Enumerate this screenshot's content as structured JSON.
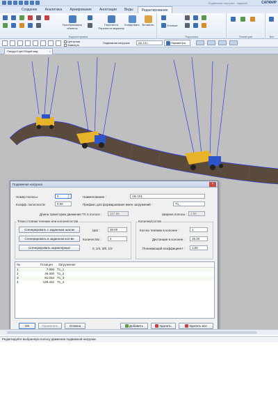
{
  "app": {
    "title": "Подвижная нагрузка - задача2",
    "brand": "САПФИР"
  },
  "tabs": [
    "Создание",
    "Аналитика",
    "Армирование",
    "Аннотации",
    "Виды",
    "Редактирование"
  ],
  "ribbon": {
    "group_left_label": "Корректировка",
    "group_mid_label": "Подложка",
    "group_geom_label": "Геометрия",
    "group_right_label": "Вкл",
    "btn_transform": "Преобразовать объекты",
    "btn_move_vertex": "Перенести вершину",
    "btn_move": "Перенести",
    "btn_copy": "Копировать",
    "btn_paste": "Вставить",
    "btn_angles": "Угловые"
  },
  "toolbar2": {
    "chk_centerline": "Центрная",
    "chk_close": "Замкнуть",
    "load_label": "Подвижная нагрузка:",
    "load_value": "АБ-151",
    "params_button": "Параметры"
  },
  "document_tab": "Пандус2.spf:Общий вид",
  "dialog": {
    "title": "Подвижная нагрузка",
    "strip_number_label": "Номер полосы:",
    "strip_number_value": "0",
    "reliability_label": "Коэфф. полосности:",
    "reliability_value": "0.00",
    "name_label": "Наименование :",
    "name_value": "АБ-151",
    "prefix_label": "Префикс для формирования имен загружений :",
    "prefix_value": "T1_",
    "trajectory_label": "Длина траектории движения ТС в полосе :",
    "trajectory_value": "157.65",
    "strip_width_label": "Ширина полосы :",
    "strip_width_value": "1.90",
    "set_title": "Точки стоянки тележек или колонн/состав",
    "btn_gen_step": "Сгенерировать с заданным шагом",
    "btn_gen_count": "Сгенерировать в заданном кол-ве",
    "btn_gen_char": "Сгенерировать характерные",
    "step_label": "Шаг :",
    "step_value": "30.00",
    "count_label": "Количество :",
    "count_value": "4",
    "fractions_hint": "0, 1/4, 3/8, 1/2",
    "column_title": "Колонна/состав",
    "carts_label": "Кол-во тележек в колонне :",
    "carts_value": "1",
    "distance_label": "Дистанция в колонне :",
    "distance_value": "16.20",
    "factor_label": "Понижающий коэффициент :",
    "factor_value": "1.00",
    "table": {
      "headers": [
        "№",
        "Позиция",
        "Загружение"
      ],
      "rows": [
        {
          "n": "1",
          "pos": "7.000",
          "load": "T1_1"
        },
        {
          "n": "2",
          "pos": "45.000",
          "load": "T1_2"
        },
        {
          "n": "3",
          "pos": "81.034",
          "load": "T1_3"
        },
        {
          "n": "4",
          "pos": "129.432",
          "load": "T1_4"
        }
      ]
    },
    "btn_ok": "ОК",
    "btn_apply": "Применить",
    "btn_cancel": "Отмена",
    "btn_add": "Добавить",
    "btn_delete": "Удалить",
    "btn_delete_all": "Удалить все"
  },
  "status": "Редактируйте выбранную полосу движения подвижной нагрузки.",
  "colors": {
    "road": "#5a4a3c",
    "truck_body": "#e7b32a",
    "truck_cab": "#2d55c9",
    "cables": "#2b3cf0",
    "viewport_bg": "#bfbfbf"
  }
}
